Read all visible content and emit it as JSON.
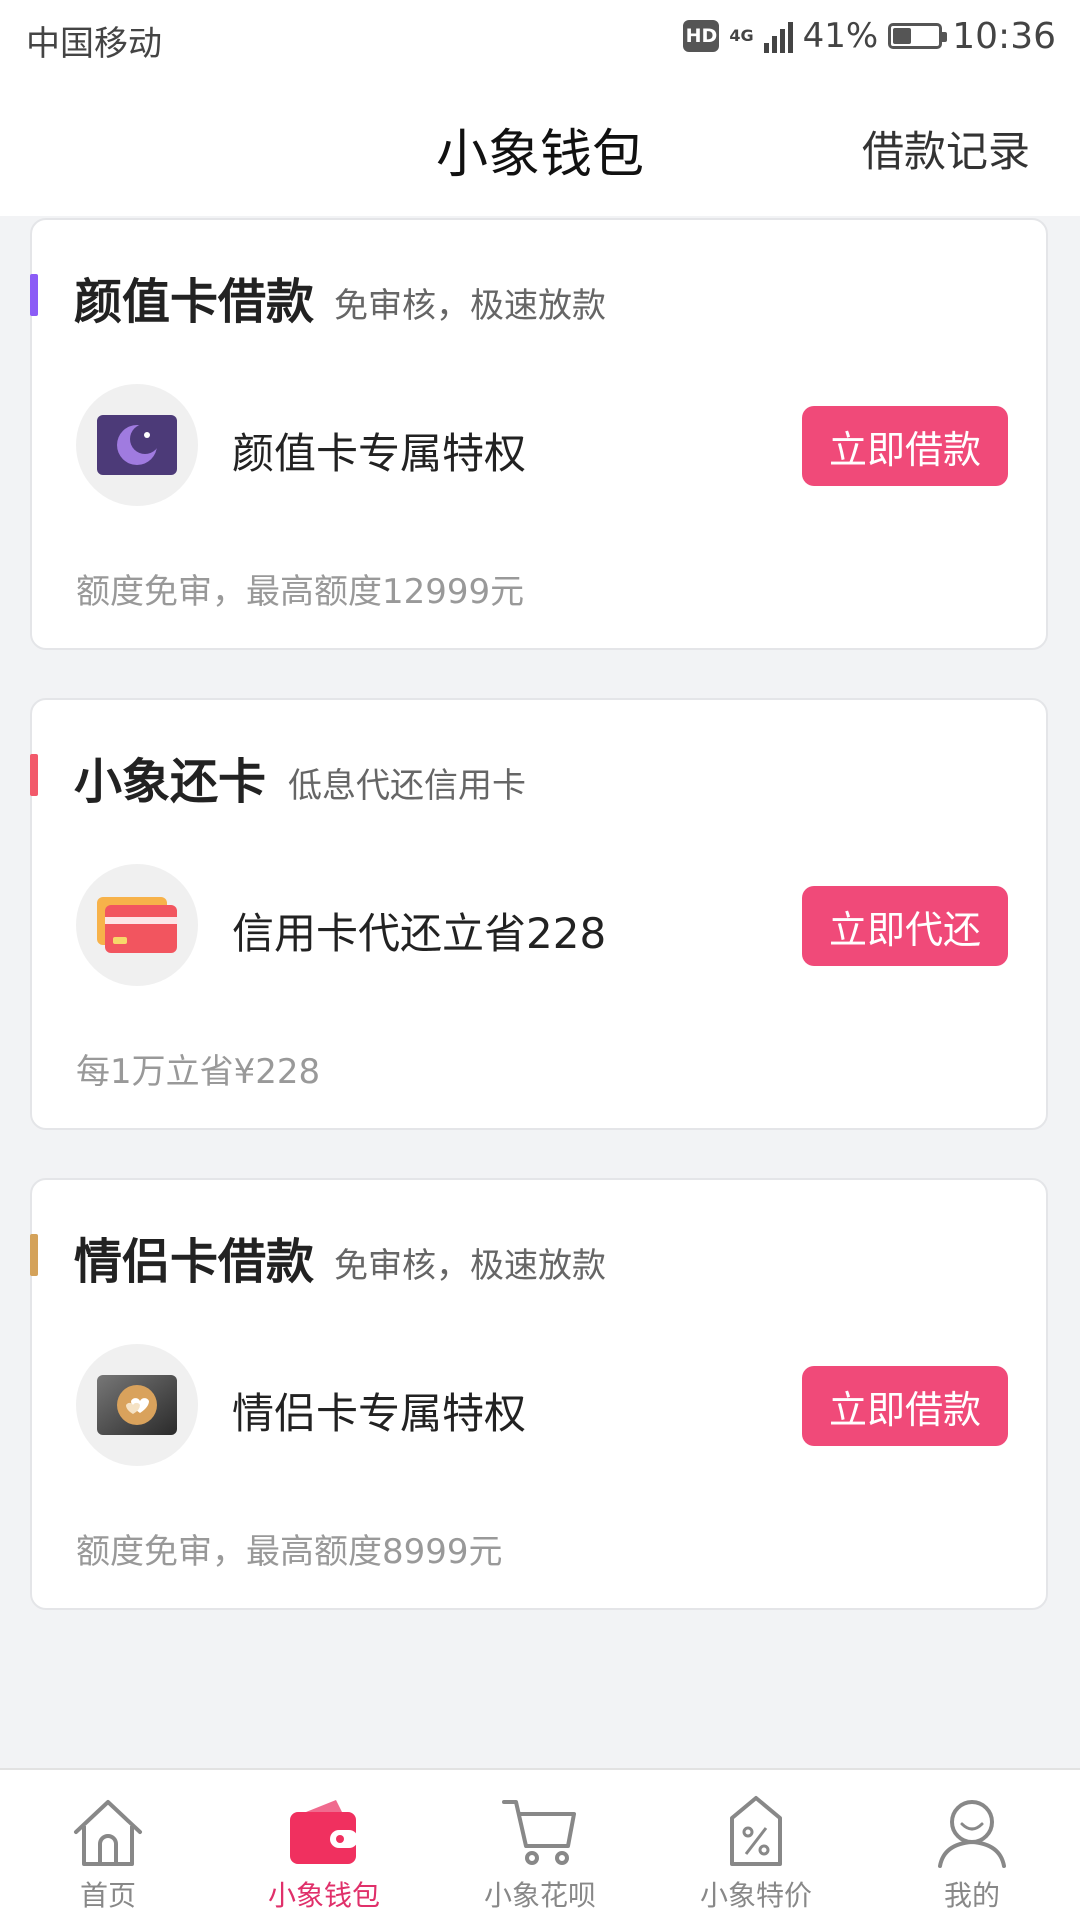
{
  "status_bar": {
    "carrier": "中国移动",
    "hd_badge": "HD",
    "network": "4G",
    "battery_percent": "41%",
    "time": "10:36"
  },
  "nav": {
    "title": "小象钱包",
    "action": "借款记录"
  },
  "cards": [
    {
      "title": "颜值卡借款",
      "subtitle": "免审核，极速放款",
      "feature": "颜值卡专属特权",
      "button": "立即借款",
      "footnote": "额度免审，最高额度12999元",
      "accent": "#8b5cf6",
      "icon": "moon-card-icon"
    },
    {
      "title": "小象还卡",
      "subtitle": "低息代还信用卡",
      "feature": "信用卡代还立省228",
      "button": "立即代还",
      "footnote": "每1万立省¥228",
      "accent": "#f25a6b",
      "icon": "credit-card-icon"
    },
    {
      "title": "情侣卡借款",
      "subtitle": "免审核，极速放款",
      "feature": "情侣卡专属特权",
      "button": "立即借款",
      "footnote": "额度免审，最高额度8999元",
      "accent": "#d4a25a",
      "icon": "heart-card-icon"
    }
  ],
  "tabs": [
    {
      "label": "首页",
      "icon": "home-icon",
      "active": false
    },
    {
      "label": "小象钱包",
      "icon": "wallet-icon",
      "active": true
    },
    {
      "label": "小象花呗",
      "icon": "cart-icon",
      "active": false
    },
    {
      "label": "小象特价",
      "icon": "discount-tag-icon",
      "active": false
    },
    {
      "label": "我的",
      "icon": "profile-icon",
      "active": false
    }
  ],
  "colors": {
    "primary": "#f04a79",
    "tab_active": "#e0306a",
    "background": "#f2f3f5"
  }
}
